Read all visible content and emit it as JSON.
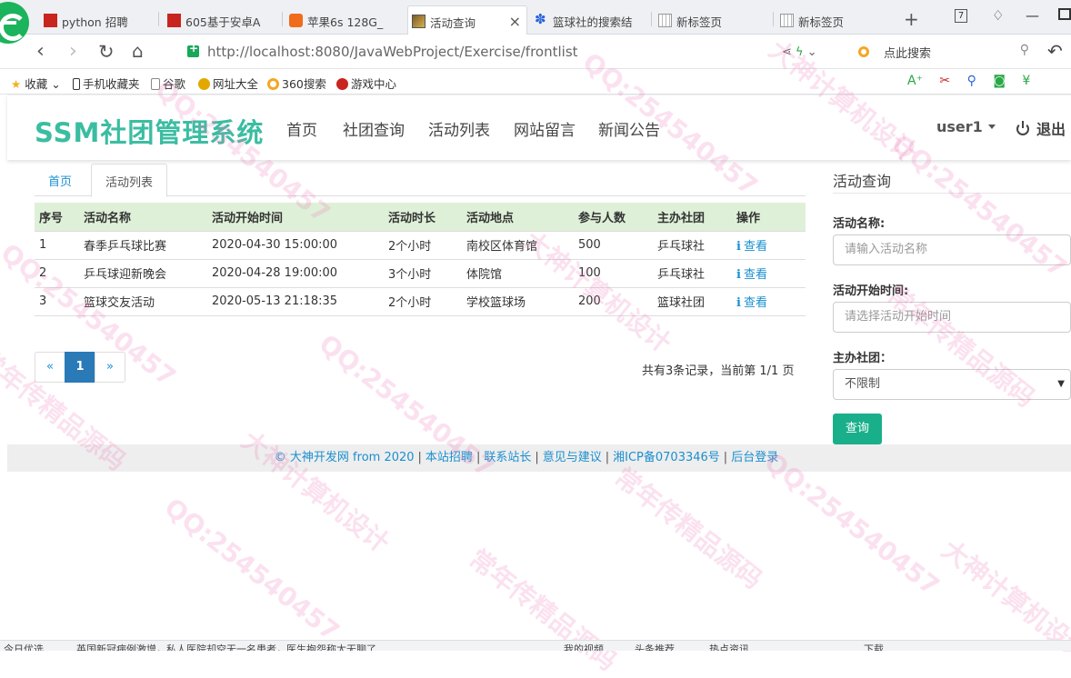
{
  "browser": {
    "tabs": [
      {
        "label": "python 招聘",
        "icon": "red-square-icon"
      },
      {
        "label": "605基于安卓A",
        "icon": "red-square-icon"
      },
      {
        "label": "苹果6s 128G_",
        "icon": "taobao-icon"
      },
      {
        "label": "活动查询",
        "icon": "page-image-icon",
        "active": true
      },
      {
        "label": "篮球社的搜索结",
        "icon": "baidu-paw-icon"
      },
      {
        "label": "新标签页",
        "icon": "grid-icon"
      },
      {
        "label": "新标签页",
        "icon": "grid-icon"
      }
    ],
    "tab_close": "×",
    "new_tab": "+",
    "tab_count": "7",
    "url": "http://localhost:8080/JavaWebProject/Exercise/frontlist",
    "search_placeholder": "点此搜索",
    "bookmarks": [
      {
        "label": "收藏",
        "icon": "star-icon",
        "color": "#f2b01e"
      },
      {
        "label": "手机收藏夹",
        "icon": "phone-icon",
        "color": "#333333"
      },
      {
        "label": "谷歌",
        "icon": "doc-icon",
        "color": "#888888"
      },
      {
        "label": "网址大全",
        "icon": "globe-icon",
        "color": "#e2a800"
      },
      {
        "label": "360搜索",
        "icon": "360-icon",
        "color": "#1fa94e"
      },
      {
        "label": "游戏中心",
        "icon": "game-icon",
        "color": "#c8251f"
      }
    ]
  },
  "site": {
    "brand": "SSM社团管理系统",
    "nav": [
      "首页",
      "社团查询",
      "活动列表",
      "网站留言",
      "新闻公告"
    ],
    "user": "user1",
    "logout": "退出"
  },
  "page_tabs": [
    "首页",
    "活动列表"
  ],
  "table": {
    "headers": [
      "序号",
      "活动名称",
      "活动开始时间",
      "活动时长",
      "活动地点",
      "参与人数",
      "主办社团",
      "操作"
    ],
    "rows": [
      {
        "no": "1",
        "name": "春季乒乓球比赛",
        "start": "2020-04-30 15:00:00",
        "duration": "2个小时",
        "place": "南校区体育馆",
        "people": "500",
        "club": "乒乓球社",
        "action": "查看"
      },
      {
        "no": "2",
        "name": "乒乓球迎新晚会",
        "start": "2020-04-28 19:00:00",
        "duration": "3个小时",
        "place": "体院馆",
        "people": "100",
        "club": "乒乓球社",
        "action": "查看"
      },
      {
        "no": "3",
        "name": "篮球交友活动",
        "start": "2020-05-13 21:18:35",
        "duration": "2个小时",
        "place": "学校篮球场",
        "people": "200",
        "club": "篮球社团",
        "action": "查看"
      }
    ]
  },
  "pagination": {
    "prev": "«",
    "current": "1",
    "next": "»",
    "summary": "共有3条记录，当前第 1/1 页"
  },
  "sidebar": {
    "title": "活动查询",
    "name_label": "活动名称:",
    "name_placeholder": "请输入活动名称",
    "time_label": "活动开始时间:",
    "time_placeholder": "请选择活动开始时间",
    "club_label": "主办社团：",
    "club_value": "不限制",
    "query_button": "查询"
  },
  "footer": {
    "links": [
      "© 大神开发网 from 2020",
      "本站招聘",
      "联系站长",
      "意见与建议",
      "湘ICP备0703346号",
      "后台登录"
    ],
    "separator": "|"
  },
  "watermark": [
    "QQ:254540457",
    "大神计算机设计",
    "常年传精品源码"
  ],
  "statusbar": [
    "今日优选",
    "英国新冠病例激增，私人医院却空无一名患者，医生抱怨称太无聊了",
    "我的视频",
    "头条推荐",
    "热点资讯",
    "下载"
  ]
}
